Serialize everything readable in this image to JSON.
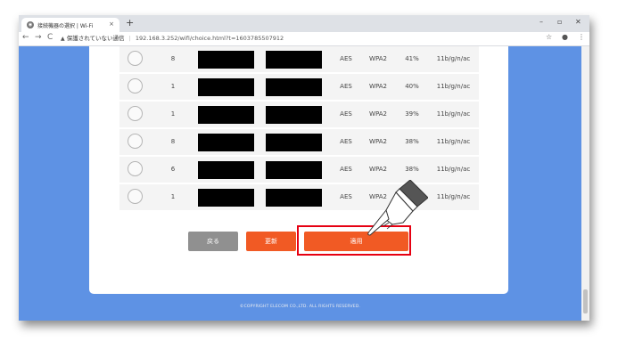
{
  "browser": {
    "tab_title": "接続機器の選択 | Wi-Fi",
    "tab_close": "×",
    "new_tab": "+",
    "window_controls": [
      "–",
      "▫",
      "✕"
    ],
    "nav_back": "←",
    "nav_forward": "→",
    "nav_reload": "C",
    "security_warning_icon": "▲",
    "security_text": "保護されていない通信",
    "url": "192.168.3.252/wifi/choice.html?t=1603785507912",
    "toolbar_icons": [
      "☆",
      "●",
      "⋮"
    ]
  },
  "table": {
    "rows": [
      {
        "channel": "8",
        "encryption": "AES",
        "auth": "WPA2",
        "signal": "41%",
        "standard": "11b/g/n/ac"
      },
      {
        "channel": "1",
        "encryption": "AES",
        "auth": "WPA2",
        "signal": "40%",
        "standard": "11b/g/n/ac"
      },
      {
        "channel": "1",
        "encryption": "AES",
        "auth": "WPA2",
        "signal": "39%",
        "standard": "11b/g/n/ac"
      },
      {
        "channel": "8",
        "encryption": "AES",
        "auth": "WPA2",
        "signal": "38%",
        "standard": "11b/g/n/ac"
      },
      {
        "channel": "6",
        "encryption": "AES",
        "auth": "WPA2",
        "signal": "38%",
        "standard": "11b/g/n/ac"
      },
      {
        "channel": "1",
        "encryption": "AES",
        "auth": "WPA2",
        "signal": "",
        "standard": "11b/g/n/ac"
      }
    ]
  },
  "buttons": {
    "back": "戻る",
    "refresh": "更新",
    "apply": "適用"
  },
  "footer": "©COPYRIGHT ELECOM CO.,LTD. ALL RIGHTS RESERVED.",
  "colors": {
    "accent": "#f15a24",
    "background": "#5e92e4",
    "highlight": "#e60012",
    "gray_button": "#909090"
  },
  "icons": {
    "pointer": "pointing-hand-icon"
  }
}
